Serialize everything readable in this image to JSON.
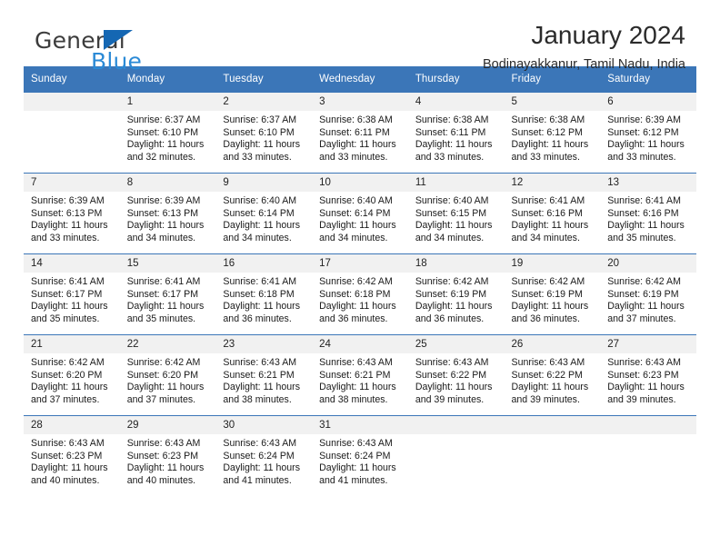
{
  "brand": {
    "name_part1": "General",
    "name_part2": "Blue",
    "triangle_color": "#1567b3",
    "blue_color": "#2b8ad6",
    "gray_color": "#3c3c3c"
  },
  "header": {
    "title": "January 2024",
    "subtitle": "Bodinayakkanur, Tamil Nadu, India"
  },
  "theme": {
    "header_blue": "#3b76b8",
    "daynum_band": "#f1f1f1",
    "cell_bg": "#ffffff",
    "text": "#1a1a1a"
  },
  "weekdays": [
    "Sunday",
    "Monday",
    "Tuesday",
    "Wednesday",
    "Thursday",
    "Friday",
    "Saturday"
  ],
  "weeks": [
    [
      {
        "day": "",
        "sunrise": "",
        "sunset": "",
        "daylight": ""
      },
      {
        "day": "1",
        "sunrise": "Sunrise: 6:37 AM",
        "sunset": "Sunset: 6:10 PM",
        "daylight": "Daylight: 11 hours and 32 minutes."
      },
      {
        "day": "2",
        "sunrise": "Sunrise: 6:37 AM",
        "sunset": "Sunset: 6:10 PM",
        "daylight": "Daylight: 11 hours and 33 minutes."
      },
      {
        "day": "3",
        "sunrise": "Sunrise: 6:38 AM",
        "sunset": "Sunset: 6:11 PM",
        "daylight": "Daylight: 11 hours and 33 minutes."
      },
      {
        "day": "4",
        "sunrise": "Sunrise: 6:38 AM",
        "sunset": "Sunset: 6:11 PM",
        "daylight": "Daylight: 11 hours and 33 minutes."
      },
      {
        "day": "5",
        "sunrise": "Sunrise: 6:38 AM",
        "sunset": "Sunset: 6:12 PM",
        "daylight": "Daylight: 11 hours and 33 minutes."
      },
      {
        "day": "6",
        "sunrise": "Sunrise: 6:39 AM",
        "sunset": "Sunset: 6:12 PM",
        "daylight": "Daylight: 11 hours and 33 minutes."
      }
    ],
    [
      {
        "day": "7",
        "sunrise": "Sunrise: 6:39 AM",
        "sunset": "Sunset: 6:13 PM",
        "daylight": "Daylight: 11 hours and 33 minutes."
      },
      {
        "day": "8",
        "sunrise": "Sunrise: 6:39 AM",
        "sunset": "Sunset: 6:13 PM",
        "daylight": "Daylight: 11 hours and 34 minutes."
      },
      {
        "day": "9",
        "sunrise": "Sunrise: 6:40 AM",
        "sunset": "Sunset: 6:14 PM",
        "daylight": "Daylight: 11 hours and 34 minutes."
      },
      {
        "day": "10",
        "sunrise": "Sunrise: 6:40 AM",
        "sunset": "Sunset: 6:14 PM",
        "daylight": "Daylight: 11 hours and 34 minutes."
      },
      {
        "day": "11",
        "sunrise": "Sunrise: 6:40 AM",
        "sunset": "Sunset: 6:15 PM",
        "daylight": "Daylight: 11 hours and 34 minutes."
      },
      {
        "day": "12",
        "sunrise": "Sunrise: 6:41 AM",
        "sunset": "Sunset: 6:16 PM",
        "daylight": "Daylight: 11 hours and 34 minutes."
      },
      {
        "day": "13",
        "sunrise": "Sunrise: 6:41 AM",
        "sunset": "Sunset: 6:16 PM",
        "daylight": "Daylight: 11 hours and 35 minutes."
      }
    ],
    [
      {
        "day": "14",
        "sunrise": "Sunrise: 6:41 AM",
        "sunset": "Sunset: 6:17 PM",
        "daylight": "Daylight: 11 hours and 35 minutes."
      },
      {
        "day": "15",
        "sunrise": "Sunrise: 6:41 AM",
        "sunset": "Sunset: 6:17 PM",
        "daylight": "Daylight: 11 hours and 35 minutes."
      },
      {
        "day": "16",
        "sunrise": "Sunrise: 6:41 AM",
        "sunset": "Sunset: 6:18 PM",
        "daylight": "Daylight: 11 hours and 36 minutes."
      },
      {
        "day": "17",
        "sunrise": "Sunrise: 6:42 AM",
        "sunset": "Sunset: 6:18 PM",
        "daylight": "Daylight: 11 hours and 36 minutes."
      },
      {
        "day": "18",
        "sunrise": "Sunrise: 6:42 AM",
        "sunset": "Sunset: 6:19 PM",
        "daylight": "Daylight: 11 hours and 36 minutes."
      },
      {
        "day": "19",
        "sunrise": "Sunrise: 6:42 AM",
        "sunset": "Sunset: 6:19 PM",
        "daylight": "Daylight: 11 hours and 36 minutes."
      },
      {
        "day": "20",
        "sunrise": "Sunrise: 6:42 AM",
        "sunset": "Sunset: 6:19 PM",
        "daylight": "Daylight: 11 hours and 37 minutes."
      }
    ],
    [
      {
        "day": "21",
        "sunrise": "Sunrise: 6:42 AM",
        "sunset": "Sunset: 6:20 PM",
        "daylight": "Daylight: 11 hours and 37 minutes."
      },
      {
        "day": "22",
        "sunrise": "Sunrise: 6:42 AM",
        "sunset": "Sunset: 6:20 PM",
        "daylight": "Daylight: 11 hours and 37 minutes."
      },
      {
        "day": "23",
        "sunrise": "Sunrise: 6:43 AM",
        "sunset": "Sunset: 6:21 PM",
        "daylight": "Daylight: 11 hours and 38 minutes."
      },
      {
        "day": "24",
        "sunrise": "Sunrise: 6:43 AM",
        "sunset": "Sunset: 6:21 PM",
        "daylight": "Daylight: 11 hours and 38 minutes."
      },
      {
        "day": "25",
        "sunrise": "Sunrise: 6:43 AM",
        "sunset": "Sunset: 6:22 PM",
        "daylight": "Daylight: 11 hours and 39 minutes."
      },
      {
        "day": "26",
        "sunrise": "Sunrise: 6:43 AM",
        "sunset": "Sunset: 6:22 PM",
        "daylight": "Daylight: 11 hours and 39 minutes."
      },
      {
        "day": "27",
        "sunrise": "Sunrise: 6:43 AM",
        "sunset": "Sunset: 6:23 PM",
        "daylight": "Daylight: 11 hours and 39 minutes."
      }
    ],
    [
      {
        "day": "28",
        "sunrise": "Sunrise: 6:43 AM",
        "sunset": "Sunset: 6:23 PM",
        "daylight": "Daylight: 11 hours and 40 minutes."
      },
      {
        "day": "29",
        "sunrise": "Sunrise: 6:43 AM",
        "sunset": "Sunset: 6:23 PM",
        "daylight": "Daylight: 11 hours and 40 minutes."
      },
      {
        "day": "30",
        "sunrise": "Sunrise: 6:43 AM",
        "sunset": "Sunset: 6:24 PM",
        "daylight": "Daylight: 11 hours and 41 minutes."
      },
      {
        "day": "31",
        "sunrise": "Sunrise: 6:43 AM",
        "sunset": "Sunset: 6:24 PM",
        "daylight": "Daylight: 11 hours and 41 minutes."
      },
      {
        "day": "",
        "sunrise": "",
        "sunset": "",
        "daylight": ""
      },
      {
        "day": "",
        "sunrise": "",
        "sunset": "",
        "daylight": ""
      },
      {
        "day": "",
        "sunrise": "",
        "sunset": "",
        "daylight": ""
      }
    ]
  ]
}
